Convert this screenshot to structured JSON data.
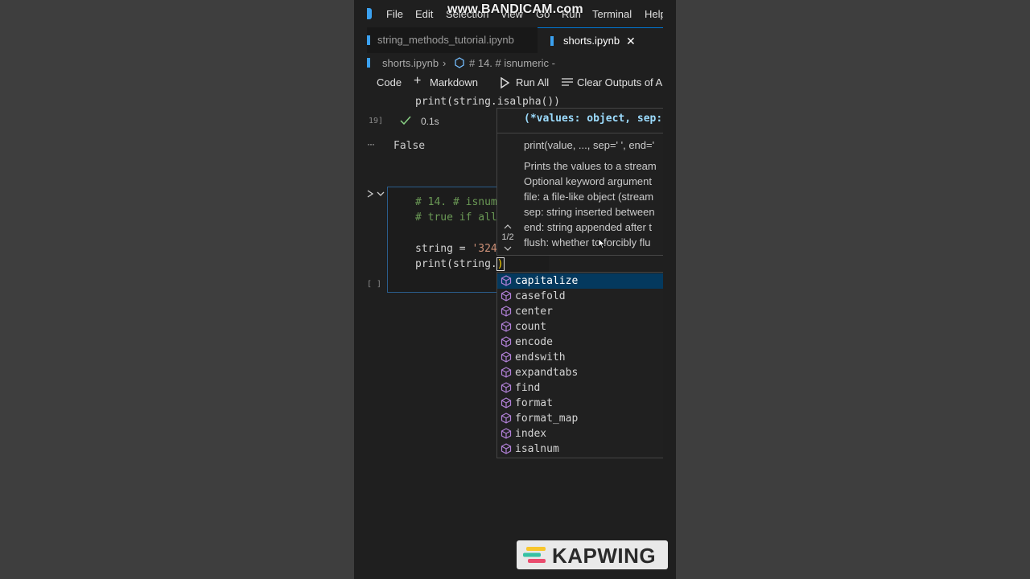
{
  "watermark": "www.BANDICAM.com",
  "menu": [
    "File",
    "Edit",
    "Selection",
    "View",
    "Go",
    "Run",
    "Terminal",
    "Help"
  ],
  "tabs": {
    "inactive": "string_methods_tutorial.ipynb",
    "active": "shorts.ipynb",
    "close_glyph": "✕"
  },
  "breadcrumb": {
    "file": "shorts.ipynb",
    "separator": "›",
    "cell": "# 14. # isnumeric -"
  },
  "toolbar": {
    "code": "Code",
    "markdown": "Markdown",
    "run_all": "Run All",
    "clear_outputs": "Clear Outputs of A"
  },
  "prev_cell": {
    "code": "print(string.isalpha())",
    "exec_count": "19]",
    "duration": "0.1s",
    "output_menu": "···",
    "output": "False"
  },
  "current_cell": {
    "exec_count": "[ ]",
    "line1": "# 14. # isnum",
    "line2": "# true if all",
    "line4_var": "string = ",
    "line4_str": "'324",
    "line5": "print(string.",
    "cursor_char": ")"
  },
  "hover": {
    "signature": "(*values: object, sep:",
    "usage": "print(value, ..., sep=' ', end='",
    "doc": [
      "Prints the values to a stream",
      "Optional keyword argument",
      "file: a file-like object (stream",
      "sep: string inserted between",
      "end: string appended after t",
      "flush: whether to forcibly flu"
    ],
    "pager": "1/2"
  },
  "suggestions": [
    "capitalize",
    "casefold",
    "center",
    "count",
    "encode",
    "endswith",
    "expandtabs",
    "find",
    "format",
    "format_map",
    "index",
    "isalnum"
  ],
  "selected_suggestion": 0,
  "badge": "KAPWING",
  "colors": {
    "accent": "#0078d4",
    "method_icon": "#b180d7",
    "comment": "#6a9955",
    "string": "#ce9178"
  }
}
